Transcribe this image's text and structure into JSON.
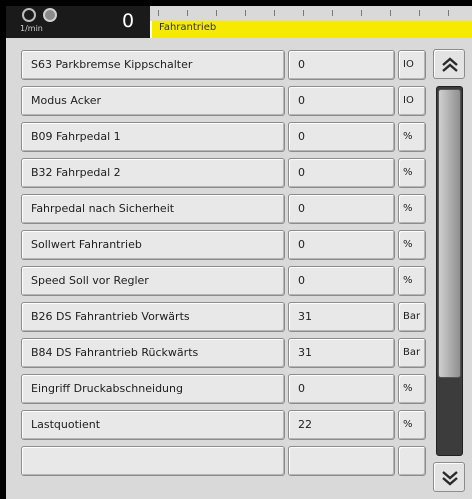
{
  "header": {
    "rpm_unit": "1/min",
    "rpm_value": "0",
    "title": "Fahrantrieb",
    "title_color": "#f5ea00"
  },
  "icons": {
    "gauge_a": "indicator-circle-icon",
    "gauge_b": "indicator-circle-filled-icon",
    "scroll_up": "double-chevron-up-icon",
    "scroll_down": "double-chevron-down-icon"
  },
  "scroll": {
    "position_fraction": 0.0,
    "visible_fraction": 0.78
  },
  "rows": [
    {
      "label": "S63 Parkbremse Kippschalter",
      "value": "0",
      "unit": "IO"
    },
    {
      "label": "Modus Acker",
      "value": "0",
      "unit": "IO"
    },
    {
      "label": "B09 Fahrpedal 1",
      "value": "0",
      "unit": "%"
    },
    {
      "label": "B32 Fahrpedal 2",
      "value": "0",
      "unit": "%"
    },
    {
      "label": "Fahrpedal nach Sicherheit",
      "value": "0",
      "unit": "%"
    },
    {
      "label": "Sollwert Fahrantrieb",
      "value": "0",
      "unit": "%"
    },
    {
      "label": "Speed Soll vor Regler",
      "value": "0",
      "unit": "%"
    },
    {
      "label": "B26 DS Fahrantrieb Vorwärts",
      "value": "31",
      "unit": "Bar"
    },
    {
      "label": "B84 DS Fahrantrieb Rückwärts",
      "value": "31",
      "unit": "Bar"
    },
    {
      "label": "Eingriff Druckabschneidung",
      "value": "0",
      "unit": "%"
    },
    {
      "label": "Lastquotient",
      "value": "22",
      "unit": "%"
    },
    {
      "label": "",
      "value": "",
      "unit": ""
    }
  ]
}
